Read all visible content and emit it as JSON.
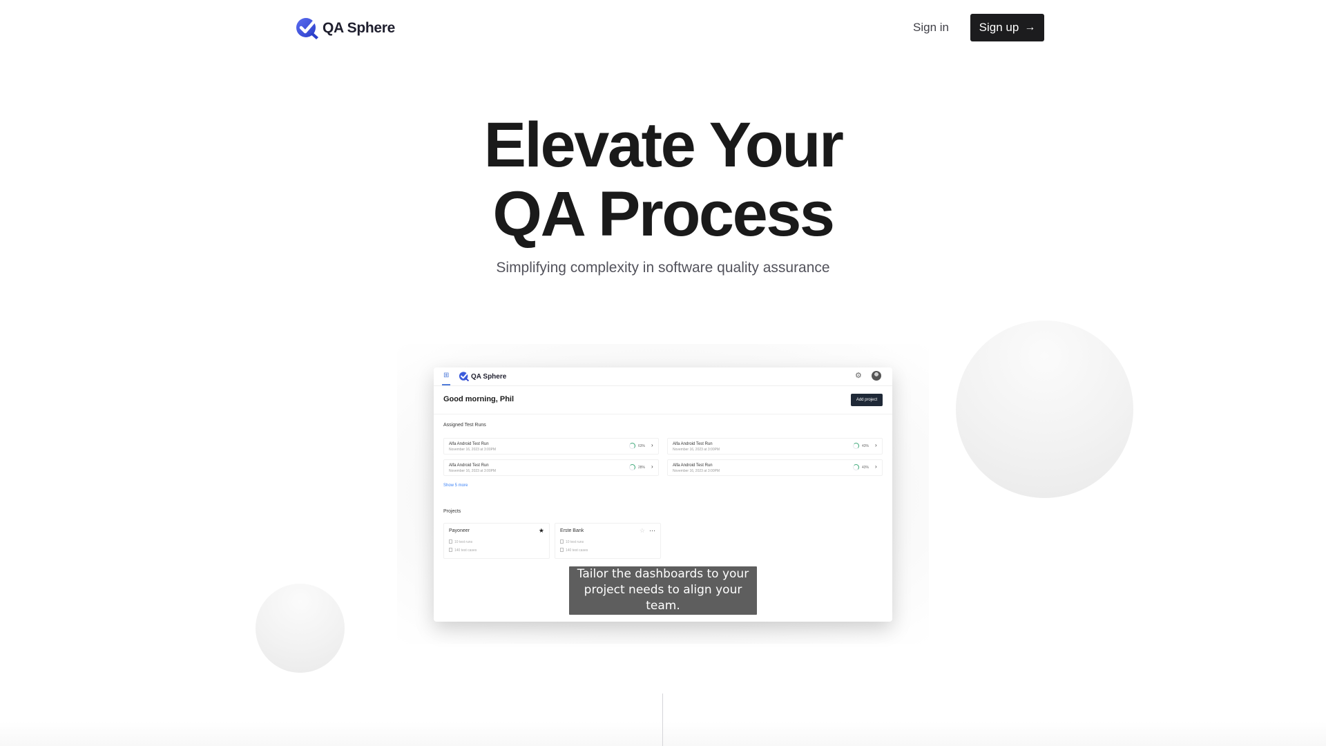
{
  "header": {
    "brand": "QA Sphere",
    "sign_in": "Sign in",
    "sign_up": "Sign up",
    "sign_up_icon": "arrow-right-icon"
  },
  "hero": {
    "title_line1": "Elevate Your",
    "title_line2": "QA Process",
    "subtitle": "Simplifying complexity in software quality assurance"
  },
  "preview": {
    "brand": "QA Sphere",
    "greeting": "Good morning, Phil",
    "add_project": "Add project",
    "assigned_title": "Assigned Test Runs",
    "runs": [
      {
        "name": "Alfa Android Test Run",
        "date": "November 16, 2023 at 3:00PM",
        "percent": "63%"
      },
      {
        "name": "Alfa Android Test Run",
        "date": "November 16, 2023 at 3:00PM",
        "percent": "43%"
      },
      {
        "name": "Alfa Android Test Run",
        "date": "November 16, 2023 at 3:00PM",
        "percent": "28%"
      },
      {
        "name": "Alfa Android Test Run",
        "date": "November 16, 2023 at 3:00PM",
        "percent": "43%"
      }
    ],
    "show_more": "Show 5 more",
    "projects_title": "Projects",
    "projects": [
      {
        "name": "Payoneer",
        "runs": "10 test runs",
        "cases": "140 test cases",
        "icon": "star-icon"
      },
      {
        "name": "Erste Bank",
        "runs": "10 test runs",
        "cases": "140 test cases",
        "icon": "more-icon"
      }
    ],
    "caption": "Tailor the dashboards to your project needs to align your team."
  },
  "colors": {
    "primary_button": "#1c1c1e",
    "brand_blue": "#3b5bdb",
    "progress_green": "#3ba776"
  }
}
